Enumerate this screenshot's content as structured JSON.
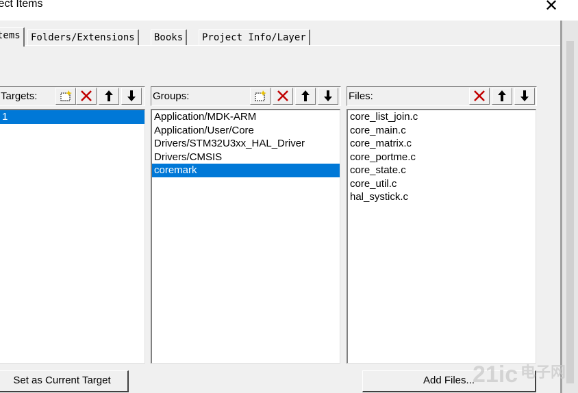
{
  "window": {
    "title": "ject Items",
    "close_glyph": "✕"
  },
  "tabs": [
    {
      "label": "tems",
      "active": true
    },
    {
      "label": "Folders/Extensions",
      "active": false
    },
    {
      "label": "Books",
      "active": false
    },
    {
      "label": "Project Info/Layer",
      "active": false
    }
  ],
  "targets": {
    "label": "Targets:",
    "items": [
      "1"
    ],
    "selected_index": 0,
    "toolbar": [
      "new-icon",
      "delete-icon",
      "move-up-icon",
      "move-down-icon"
    ]
  },
  "groups": {
    "label": "Groups:",
    "items": [
      "Application/MDK-ARM",
      "Application/User/Core",
      "Drivers/STM32U3xx_HAL_Driver",
      "Drivers/CMSIS",
      "coremark"
    ],
    "selected_index": 4,
    "toolbar": [
      "new-icon",
      "delete-icon",
      "move-up-icon",
      "move-down-icon"
    ]
  },
  "files": {
    "label": "Files:",
    "items": [
      "core_list_join.c",
      "core_main.c",
      "core_matrix.c",
      "core_portme.c",
      "core_state.c",
      "core_util.c",
      "hal_systick.c"
    ],
    "toolbar": [
      "delete-icon",
      "move-up-icon",
      "move-down-icon"
    ]
  },
  "buttons": {
    "set_current_target": "Set as Current Target",
    "add_files": "Add Files..."
  },
  "watermark": {
    "logo": "21ic",
    "text": "电子网"
  },
  "colors": {
    "selection": "#0078d7",
    "delete_red": "#c00000"
  }
}
